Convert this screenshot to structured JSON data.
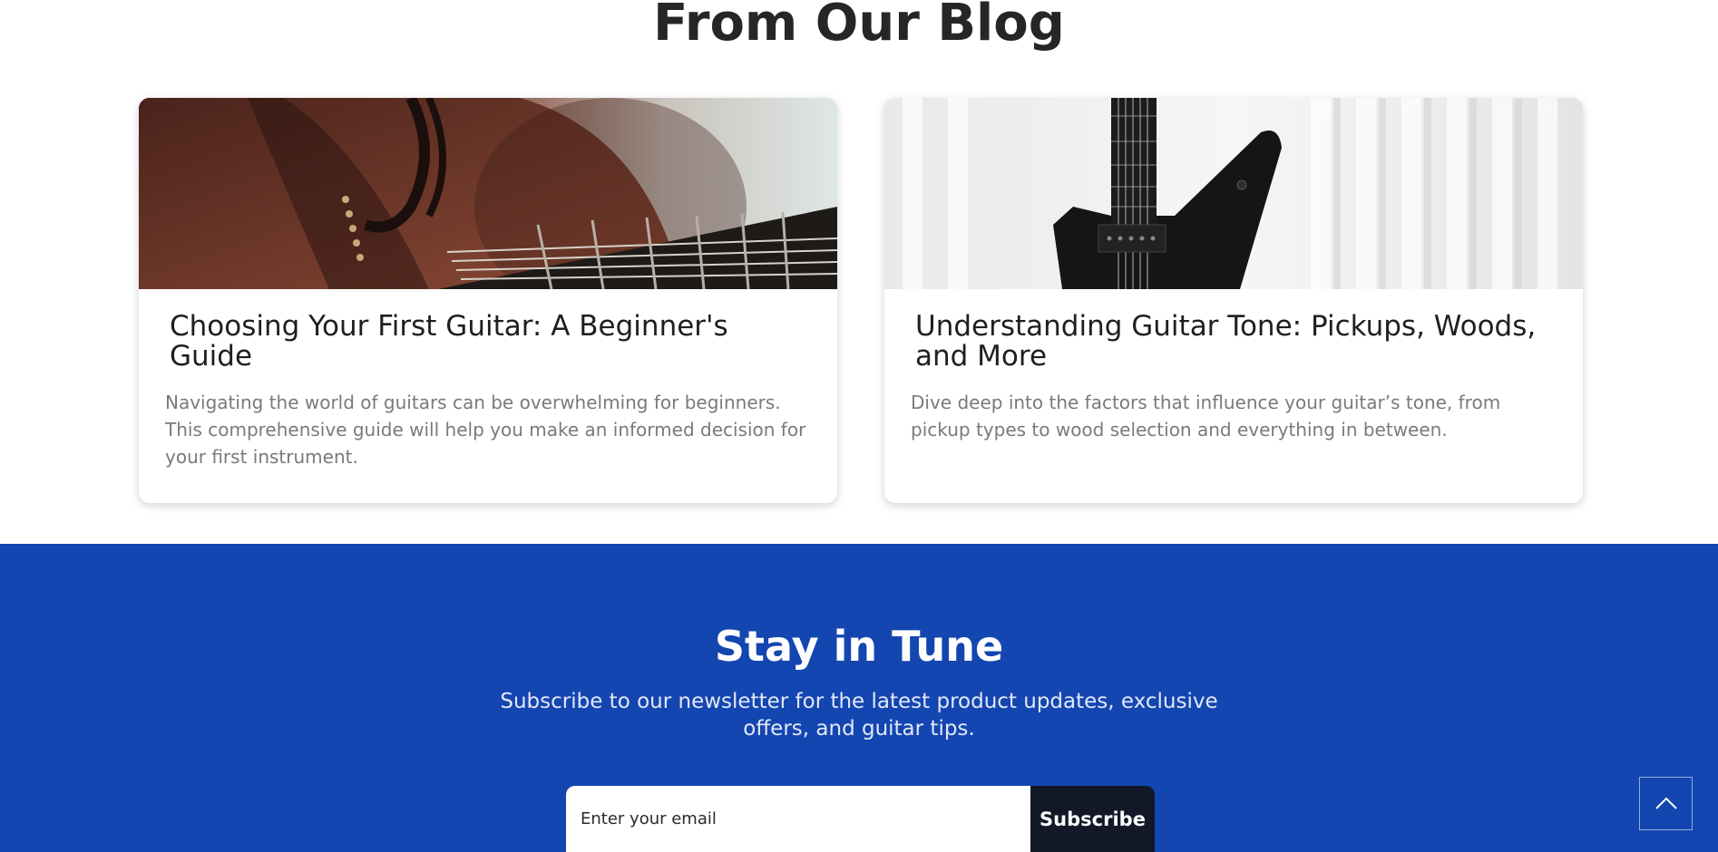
{
  "blog": {
    "heading": "From Our Blog",
    "posts": [
      {
        "title": "Choosing Your First Guitar: A Beginner's Guide",
        "excerpt": "Navigating the world of guitars can be overwhelming for beginners. This comprehensive guide will help you make an informed decision for your first instrument.",
        "image": "acoustic-guitar-closeup-photo"
      },
      {
        "title": "Understanding Guitar Tone: Pickups, Woods, and More",
        "excerpt": "Dive deep into the factors that influence your guitar’s tone, from pickup types to wood selection and everything in between.",
        "image": "black-electric-guitar-photo"
      }
    ]
  },
  "newsletter": {
    "heading": "Stay in Tune",
    "subtitle": "Subscribe to our newsletter for the latest product updates, exclusive offers, and guitar tips.",
    "email_placeholder": "Enter your email",
    "subscribe_label": "Subscribe",
    "background_color": "#1446b1",
    "button_color": "#121826"
  },
  "back_to_top": {
    "icon": "chevron-up-icon"
  }
}
